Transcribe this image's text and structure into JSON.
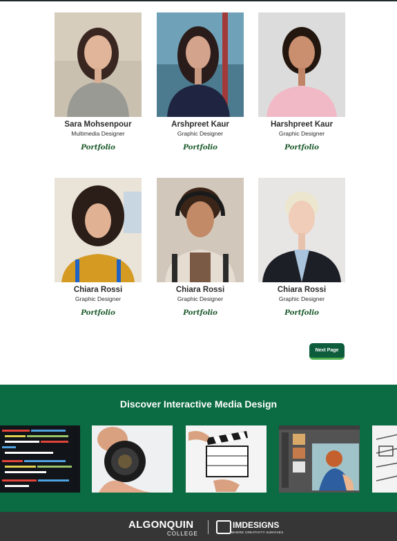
{
  "team": [
    {
      "name": "Sara Mohsenpour",
      "role": "Multimedia Designer",
      "link": "Portfolio"
    },
    {
      "name": "Arshpreet Kaur",
      "role": "Graphic Designer",
      "link": "Portfolio"
    },
    {
      "name": "Harshpreet Kaur",
      "role": "Graphic Designer",
      "link": "Portfolio"
    },
    {
      "name": "Chiara Rossi",
      "role": "Graphic Designer",
      "link": "Portfolio"
    },
    {
      "name": "Chiara Rossi",
      "role": "Graphic Designer",
      "link": "Portfolio"
    },
    {
      "name": "Chiara Rossi",
      "role": "Graphic Designer",
      "link": "Portfolio"
    }
  ],
  "pagination": {
    "next_label": "Next Page"
  },
  "discover": {
    "title": "Discover Interactive Media Design"
  },
  "footer": {
    "college_name": "ALGONQUIN",
    "college_sub": "COLLEGE",
    "brand": "IMDESIGNS",
    "brand_tagline": "WHERE CREATIVITY SURVIVES"
  },
  "colors": {
    "brand_green": "#0b6b42",
    "button_green": "#0d5c3c",
    "button_accent": "#4fb04d",
    "footer_gray": "#363636"
  }
}
